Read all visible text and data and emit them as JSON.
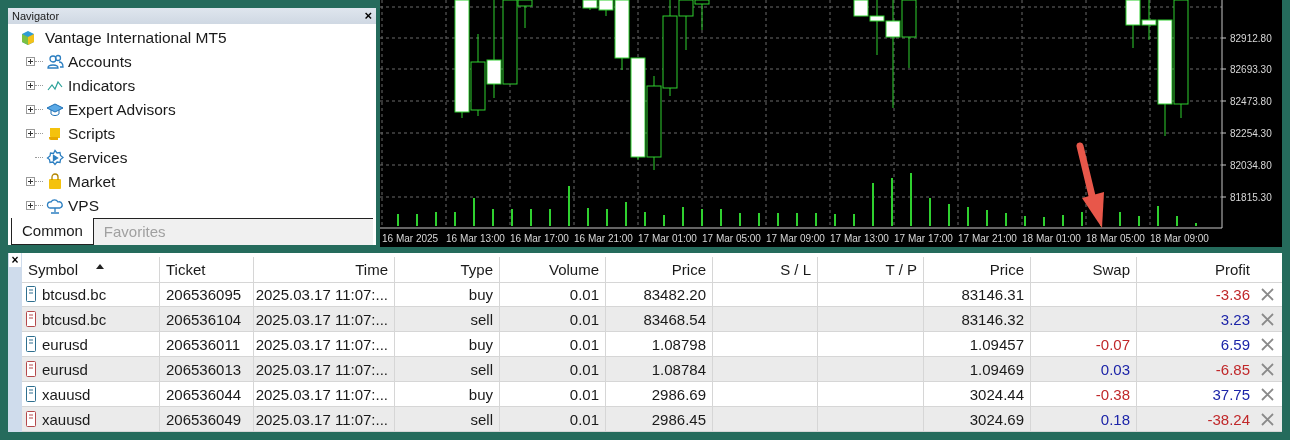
{
  "navigator": {
    "title": "Navigator",
    "close": "×",
    "root": "Vantage International MT5",
    "items": [
      {
        "label": "Accounts",
        "has_children": true
      },
      {
        "label": "Indicators",
        "has_children": true
      },
      {
        "label": "Expert Advisors",
        "has_children": true
      },
      {
        "label": "Scripts",
        "has_children": true
      },
      {
        "label": "Services",
        "has_children": false
      },
      {
        "label": "Market",
        "has_children": true
      },
      {
        "label": "VPS",
        "has_children": true
      }
    ],
    "tabs": [
      {
        "label": "Common",
        "selected": true
      },
      {
        "label": "Favorites",
        "selected": false
      }
    ]
  },
  "chart": {
    "price_labels": [
      "82912.80",
      "82693.30",
      "82473.80",
      "82254.30",
      "82034.80",
      "81815.30"
    ],
    "time_labels": [
      "16 Mar 2025",
      "16 Mar 13:00",
      "16 Mar 17:00",
      "16 Mar 21:00",
      "17 Mar 01:00",
      "17 Mar 05:00",
      "17 Mar 09:00",
      "17 Mar 13:00",
      "17 Mar 17:00",
      "17 Mar 21:00",
      "18 Mar 01:00",
      "18 Mar 05:00",
      "18 Mar 09:00"
    ]
  },
  "trade": {
    "close": "×",
    "columns": [
      {
        "label": "Symbol",
        "sorted": true
      },
      {
        "label": "Ticket",
        "sorted": false
      },
      {
        "label": "Time",
        "sorted": false
      },
      {
        "label": "Type",
        "sorted": false
      },
      {
        "label": "Volume",
        "sorted": false
      },
      {
        "label": "Price",
        "sorted": false
      },
      {
        "label": "S / L",
        "sorted": false
      },
      {
        "label": "T / P",
        "sorted": false
      },
      {
        "label": "Price",
        "sorted": false
      },
      {
        "label": "Swap",
        "sorted": false
      },
      {
        "label": "Profit",
        "sorted": false
      }
    ],
    "rows": [
      {
        "kind": "buy",
        "symbol": "btcusd.bc",
        "ticket": "206536095",
        "time": "2025.03.17 11:07:...",
        "type": "buy",
        "volume": "0.01",
        "price": "83482.20",
        "current": "83146.31",
        "profit": {
          "text": "-3.36",
          "negative": true
        }
      },
      {
        "kind": "sell",
        "symbol": "btcusd.bc",
        "ticket": "206536104",
        "time": "2025.03.17 11:07:...",
        "type": "sell",
        "volume": "0.01",
        "price": "83468.54",
        "current": "83146.32",
        "profit": {
          "text": "3.23",
          "negative": false
        }
      },
      {
        "kind": "buy",
        "symbol": "eurusd",
        "ticket": "206536011",
        "time": "2025.03.17 11:07:...",
        "type": "buy",
        "volume": "0.01",
        "price": "1.08798",
        "current": "1.09457",
        "swap": {
          "text": "-0.07",
          "negative": true
        },
        "profit": {
          "text": "6.59",
          "negative": false
        }
      },
      {
        "kind": "sell",
        "symbol": "eurusd",
        "ticket": "206536013",
        "time": "2025.03.17 11:07:...",
        "type": "sell",
        "volume": "0.01",
        "price": "1.08784",
        "current": "1.09469",
        "swap": {
          "text": "0.03",
          "negative": false
        },
        "profit": {
          "text": "-6.85",
          "negative": true
        }
      },
      {
        "kind": "buy",
        "symbol": "xauusd",
        "ticket": "206536044",
        "time": "2025.03.17 11:07:...",
        "type": "buy",
        "volume": "0.01",
        "price": "2986.69",
        "current": "3024.44",
        "swap": {
          "text": "-0.38",
          "negative": true
        },
        "profit": {
          "text": "37.75",
          "negative": false
        }
      },
      {
        "kind": "sell",
        "symbol": "xauusd",
        "ticket": "206536049",
        "time": "2025.03.17 11:07:...",
        "type": "sell",
        "volume": "0.01",
        "price": "2986.45",
        "current": "3024.69",
        "swap": {
          "text": "0.18",
          "negative": false
        },
        "profit": {
          "text": "-38.24",
          "negative": true
        }
      }
    ]
  }
}
